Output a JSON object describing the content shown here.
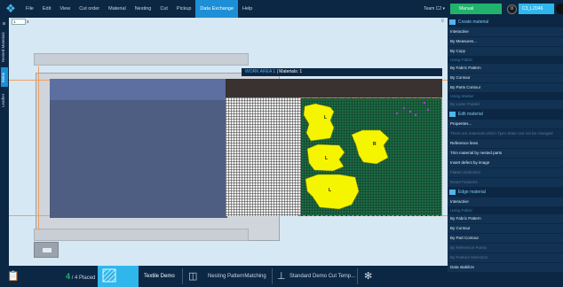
{
  "menu": {
    "items": [
      "File",
      "Edit",
      "View",
      "Cut order",
      "Material",
      "Nesting",
      "Cut",
      "Pickup",
      "Data Exchange",
      "Help"
    ],
    "active_index": 8,
    "team_label": "Team C2 ▾",
    "mode_label": "Manual",
    "pause_icon": "II",
    "user_label": "C3_LZ046"
  },
  "left_tabs": [
    "Nested Materials",
    "Items",
    "Leather"
  ],
  "left_tab_active": 1,
  "canvas": {
    "zoom_value": "1",
    "zoom_suffix": "x",
    "menu_icon": "≡",
    "work_area_title": "WORK AREA 1",
    "work_area_materials": "Materials: 1",
    "piece_labels": [
      "L",
      "R",
      "L",
      "L"
    ]
  },
  "panel": {
    "create_header": "Create material",
    "create_buttons": [
      "Interactive",
      "By Measures...",
      "By Copy"
    ],
    "using_fabric_label": "Using Fabric",
    "fabric_buttons": [
      "By Fabric Pattern",
      "By Contour",
      "By Parts Contour"
    ],
    "using_marker_label": "Using Marker",
    "marker_button": "By Laser Pointer",
    "edit_header": "Edit material",
    "edit_buttons": [
      "Properties..."
    ],
    "edit_note": "There are materials which Tjum State can not be changed",
    "edit_buttons_2": [
      "Reference lines",
      "Trim material by nested parts",
      "Insert defect by image",
      "Flatten Defection",
      "Reset Features"
    ],
    "edge_header": "Edge material",
    "edge_buttons": [
      "Interactive"
    ],
    "using_fabric_label_2": "Using Fabric",
    "edge_fabric_buttons": [
      "By Fabric Pattern",
      "By Contour",
      "By Part Contour",
      "By Reference Points",
      "By Feature Detection",
      "Data stabilize"
    ]
  },
  "bottom": {
    "placed_count": "4",
    "placed_total": "/ 4 Placed",
    "material_name": "Textile Demo",
    "nesting_profile": "Nesting PatternMatching",
    "cut_template": "Standard Demo Cut Temp..."
  },
  "colors": {
    "app_bg": "#0c2744",
    "accent": "#1c8fd6",
    "highlight": "#2fb7ec",
    "success": "#21b36b",
    "piece_fill": "#f5f500",
    "canvas_bg": "#d6e8f4"
  }
}
